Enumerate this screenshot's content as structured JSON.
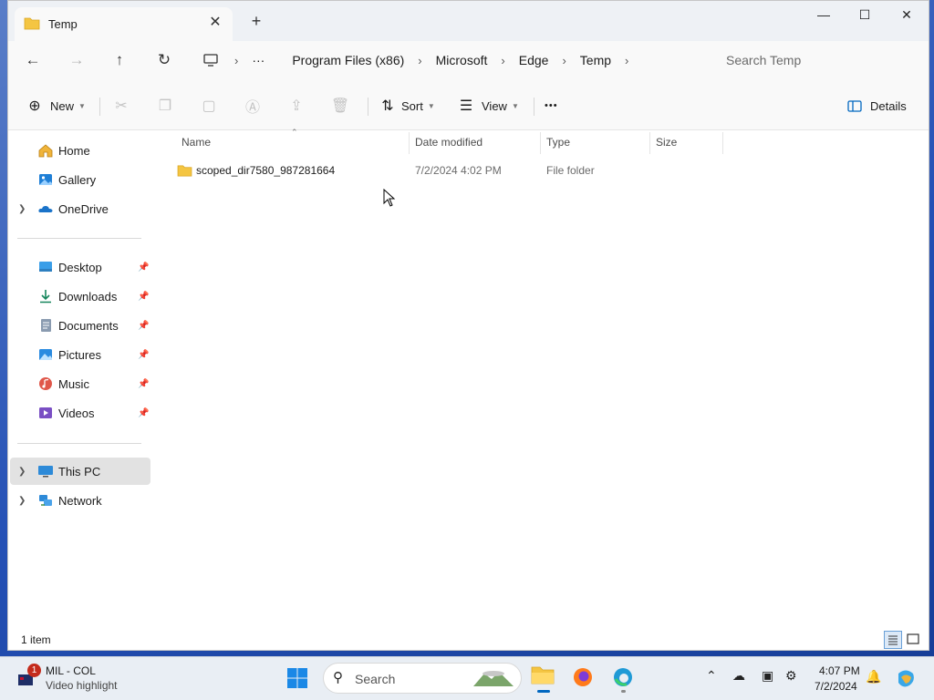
{
  "window": {
    "tab_title": "Temp",
    "close_tab_glyph": "✕",
    "new_tab_glyph": "+",
    "minimize_glyph": "—",
    "maximize_glyph": "☐",
    "close_glyph": "✕"
  },
  "address": {
    "overflow": "···",
    "crumbs": [
      "Program Files (x86)",
      "Microsoft",
      "Edge",
      "Temp"
    ],
    "search_placeholder": "Search Temp"
  },
  "toolbar": {
    "new_label": "New",
    "sort_label": "Sort",
    "view_label": "View",
    "more_glyph": "•••",
    "details_label": "Details"
  },
  "sidebar": {
    "quick": [
      {
        "label": "Home",
        "icon": "home-icon"
      },
      {
        "label": "Gallery",
        "icon": "gallery-icon"
      },
      {
        "label": "OneDrive",
        "icon": "onedrive-icon"
      }
    ],
    "pinned": [
      {
        "label": "Desktop",
        "icon": "desktop-icon"
      },
      {
        "label": "Downloads",
        "icon": "downloads-icon"
      },
      {
        "label": "Documents",
        "icon": "documents-icon"
      },
      {
        "label": "Pictures",
        "icon": "pictures-icon"
      },
      {
        "label": "Music",
        "icon": "music-icon"
      },
      {
        "label": "Videos",
        "icon": "videos-icon"
      }
    ],
    "devices": [
      {
        "label": "This PC",
        "icon": "this-pc-icon"
      },
      {
        "label": "Network",
        "icon": "network-icon"
      }
    ]
  },
  "columns": {
    "name": "Name",
    "date": "Date modified",
    "type": "Type",
    "size": "Size"
  },
  "files": [
    {
      "name": "scoped_dir7580_987281664",
      "date": "7/2/2024 4:02 PM",
      "type": "File folder",
      "size": ""
    }
  ],
  "status": {
    "item_count": "1 item"
  },
  "taskbar": {
    "notification_badge": "1",
    "weather_title": "MIL - COL",
    "weather_sub": "Video highlight",
    "search_label": "Search",
    "time": "4:07 PM",
    "date": "7/2/2024"
  },
  "colors": {
    "accent": "#0067c0",
    "folder": "#f4c542",
    "selected": "#e2e2e2"
  }
}
